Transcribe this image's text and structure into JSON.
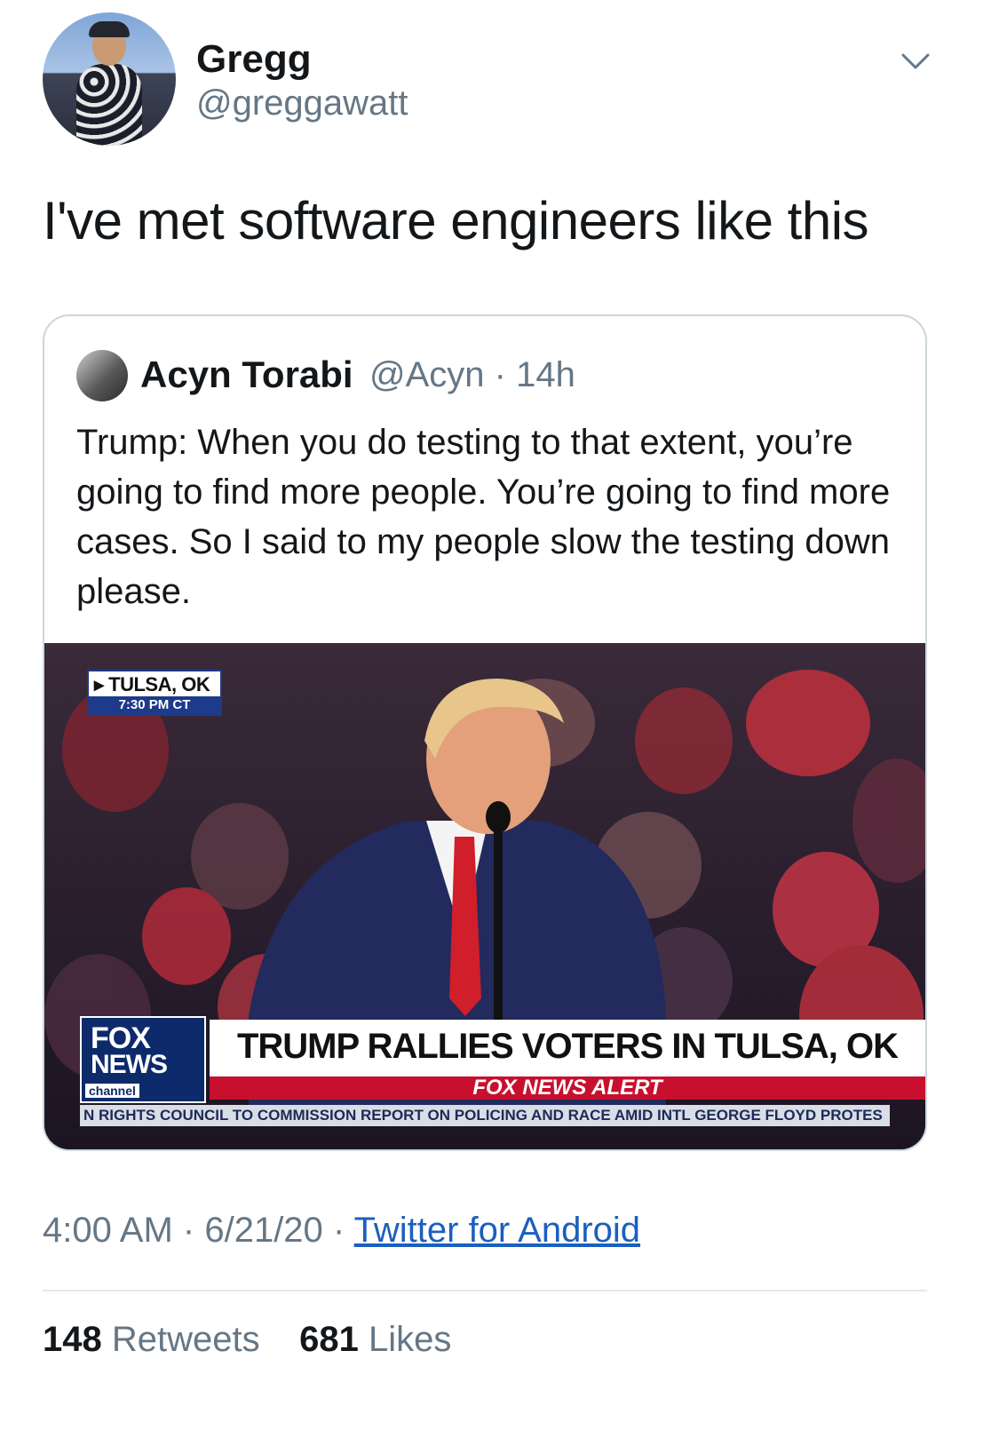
{
  "author": {
    "name": "Gregg",
    "handle": "@greggawatt"
  },
  "tweet": {
    "text": "I've met software engineers like this",
    "time": "4:00 AM",
    "date": "6/21/20",
    "separator": "·",
    "source": "Twitter for Android"
  },
  "quoted": {
    "name": "Acyn Torabi",
    "handle": "@Acyn",
    "age": "14h",
    "text": "Trump: When you do testing to that extent, you’re going to find more people. You’re going to find more cases. So I said to my people slow the testing down please.",
    "media": {
      "location": "▸ TULSA, OK",
      "time": "7:30 PM CT",
      "logo_line1": "FOX",
      "logo_line2": "NEWS",
      "logo_line3": "channel",
      "headline": "TRUMP RALLIES VOTERS IN TULSA, OK",
      "alert": "FOX NEWS ALERT",
      "ticker": "N RIGHTS COUNCIL TO COMMISSION REPORT ON POLICING AND RACE AMID INTL GEORGE FLOYD PROTES"
    }
  },
  "stats": {
    "retweets": "148",
    "retweets_label": "Retweets",
    "likes": "681",
    "likes_label": "Likes"
  },
  "icons": {
    "menu": "chevron-down-icon"
  }
}
